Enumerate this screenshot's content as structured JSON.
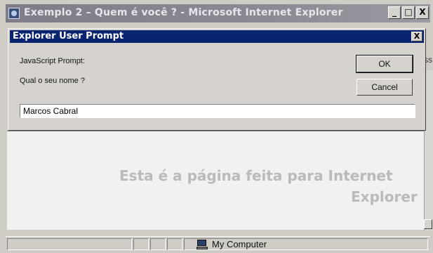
{
  "browser": {
    "title": "Exemplo 2 – Quem é você ? - Microsoft Internet Explorer",
    "buttons": {
      "minimize": "_",
      "maximize": "□",
      "close": "X"
    },
    "side_fragment": "ss",
    "background_text_line1": "Esta é a página feita para Internet",
    "background_text_line2": "Explorer",
    "status_zone": "My Computer"
  },
  "dialog": {
    "title": "Explorer User Prompt",
    "close": "X",
    "prompt_header": "JavaScript Prompt:",
    "prompt_question": "Qual o seu nome ?",
    "ok_label": "OK",
    "cancel_label": "Cancel",
    "input_value": "Marcos Cabral"
  }
}
